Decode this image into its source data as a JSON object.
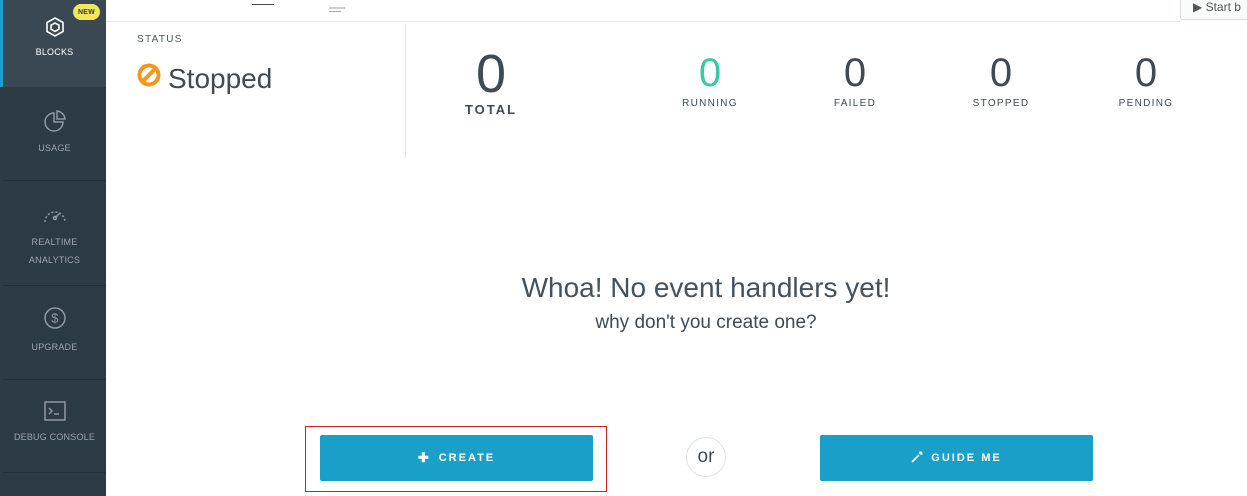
{
  "sidebar": {
    "items": [
      {
        "label": "BLOCKS",
        "icon": "blocks-icon",
        "badge": "NEW",
        "active": true
      },
      {
        "label": "USAGE",
        "icon": "pie-chart-icon"
      },
      {
        "label": "REALTIME ANALYTICS",
        "label_line1": "REALTIME",
        "label_line2": "ANALYTICS",
        "icon": "speedometer-icon"
      },
      {
        "label": "UPGRADE",
        "icon": "dollar-icon"
      },
      {
        "label": "DEBUG CONSOLE",
        "icon": "terminal-icon"
      }
    ]
  },
  "topbar": {
    "start_button_label": "▶ Start b"
  },
  "status": {
    "label": "STATUS",
    "value": "Stopped",
    "icon": "stopped-icon",
    "icon_color": "#f5961d"
  },
  "stats": {
    "total": {
      "value": "0",
      "label": "TOTAL"
    },
    "running": {
      "value": "0",
      "label": "RUNNING",
      "color": "#3cc8a0"
    },
    "failed": {
      "value": "0",
      "label": "FAILED"
    },
    "stopped": {
      "value": "0",
      "label": "STOPPED"
    },
    "pending": {
      "value": "0",
      "label": "PENDING"
    }
  },
  "empty_state": {
    "title": "Whoa! No event handlers yet!",
    "subtitle": "why don't you create one?",
    "create_label": "CREATE",
    "or_label": "or",
    "guide_label": "GUIDE ME"
  },
  "colors": {
    "sidebar_bg": "#2c3a45",
    "accent": "#1aa0c8",
    "badge": "#f4e65a",
    "highlight": "#cc2222"
  }
}
